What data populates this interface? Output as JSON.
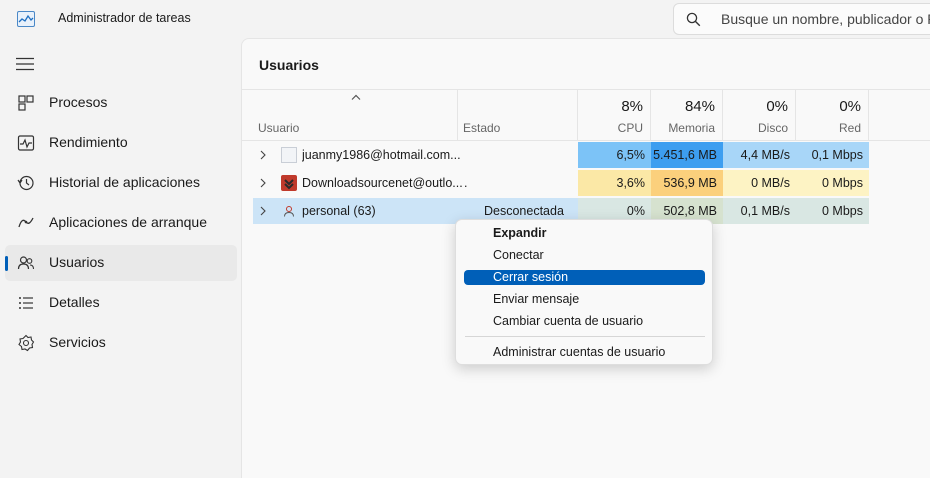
{
  "titlebar": {
    "title": "Administrador de tareas",
    "search_placeholder": "Busque un nombre, publicador o PID"
  },
  "sidebar": {
    "items": [
      {
        "label": "Procesos",
        "icon": "processes-icon"
      },
      {
        "label": "Rendimiento",
        "icon": "performance-icon"
      },
      {
        "label": "Historial de aplicaciones",
        "icon": "history-icon"
      },
      {
        "label": "Aplicaciones de arranque",
        "icon": "startup-icon"
      },
      {
        "label": "Usuarios",
        "icon": "users-icon",
        "active": true
      },
      {
        "label": "Detalles",
        "icon": "details-icon"
      },
      {
        "label": "Servicios",
        "icon": "services-icon"
      }
    ]
  },
  "main": {
    "title": "Usuarios",
    "columns": {
      "user": "Usuario",
      "state": "Estado",
      "cpu": {
        "pct": "8%",
        "name": "CPU"
      },
      "memory": {
        "pct": "84%",
        "name": "Memoria"
      },
      "disk": {
        "pct": "0%",
        "name": "Disco"
      },
      "network": {
        "pct": "0%",
        "name": "Red"
      }
    },
    "rows": [
      {
        "name": "juanmy1986@hotmail.com...",
        "state": "",
        "cpu": "6,5%",
        "memory": "5.451,6 MB",
        "disk": "4,4 MB/s",
        "network": "0,1 Mbps"
      },
      {
        "name": "Downloadsourcenet@outlo...",
        "state": ".",
        "cpu": "3,6%",
        "memory": "536,9 MB",
        "disk": "0 MB/s",
        "network": "0 Mbps"
      },
      {
        "name": "personal (63)",
        "state": "Desconectada",
        "cpu": "0%",
        "memory": "502,8 MB",
        "disk": "0,1 MB/s",
        "network": "0 Mbps"
      }
    ]
  },
  "context_menu": {
    "items": [
      "Expandir",
      "Conectar",
      "Cerrar sesión",
      "Enviar mensaje",
      "Cambiar cuenta de usuario",
      "Administrar cuentas de usuario"
    ]
  },
  "colors": {
    "accent": "#005fb8",
    "heat_strong": "#7cc3f7",
    "heat_mid": "#fbe8a6",
    "heat_orange": "#fbd07c",
    "selected_row": "#cce4f7"
  }
}
